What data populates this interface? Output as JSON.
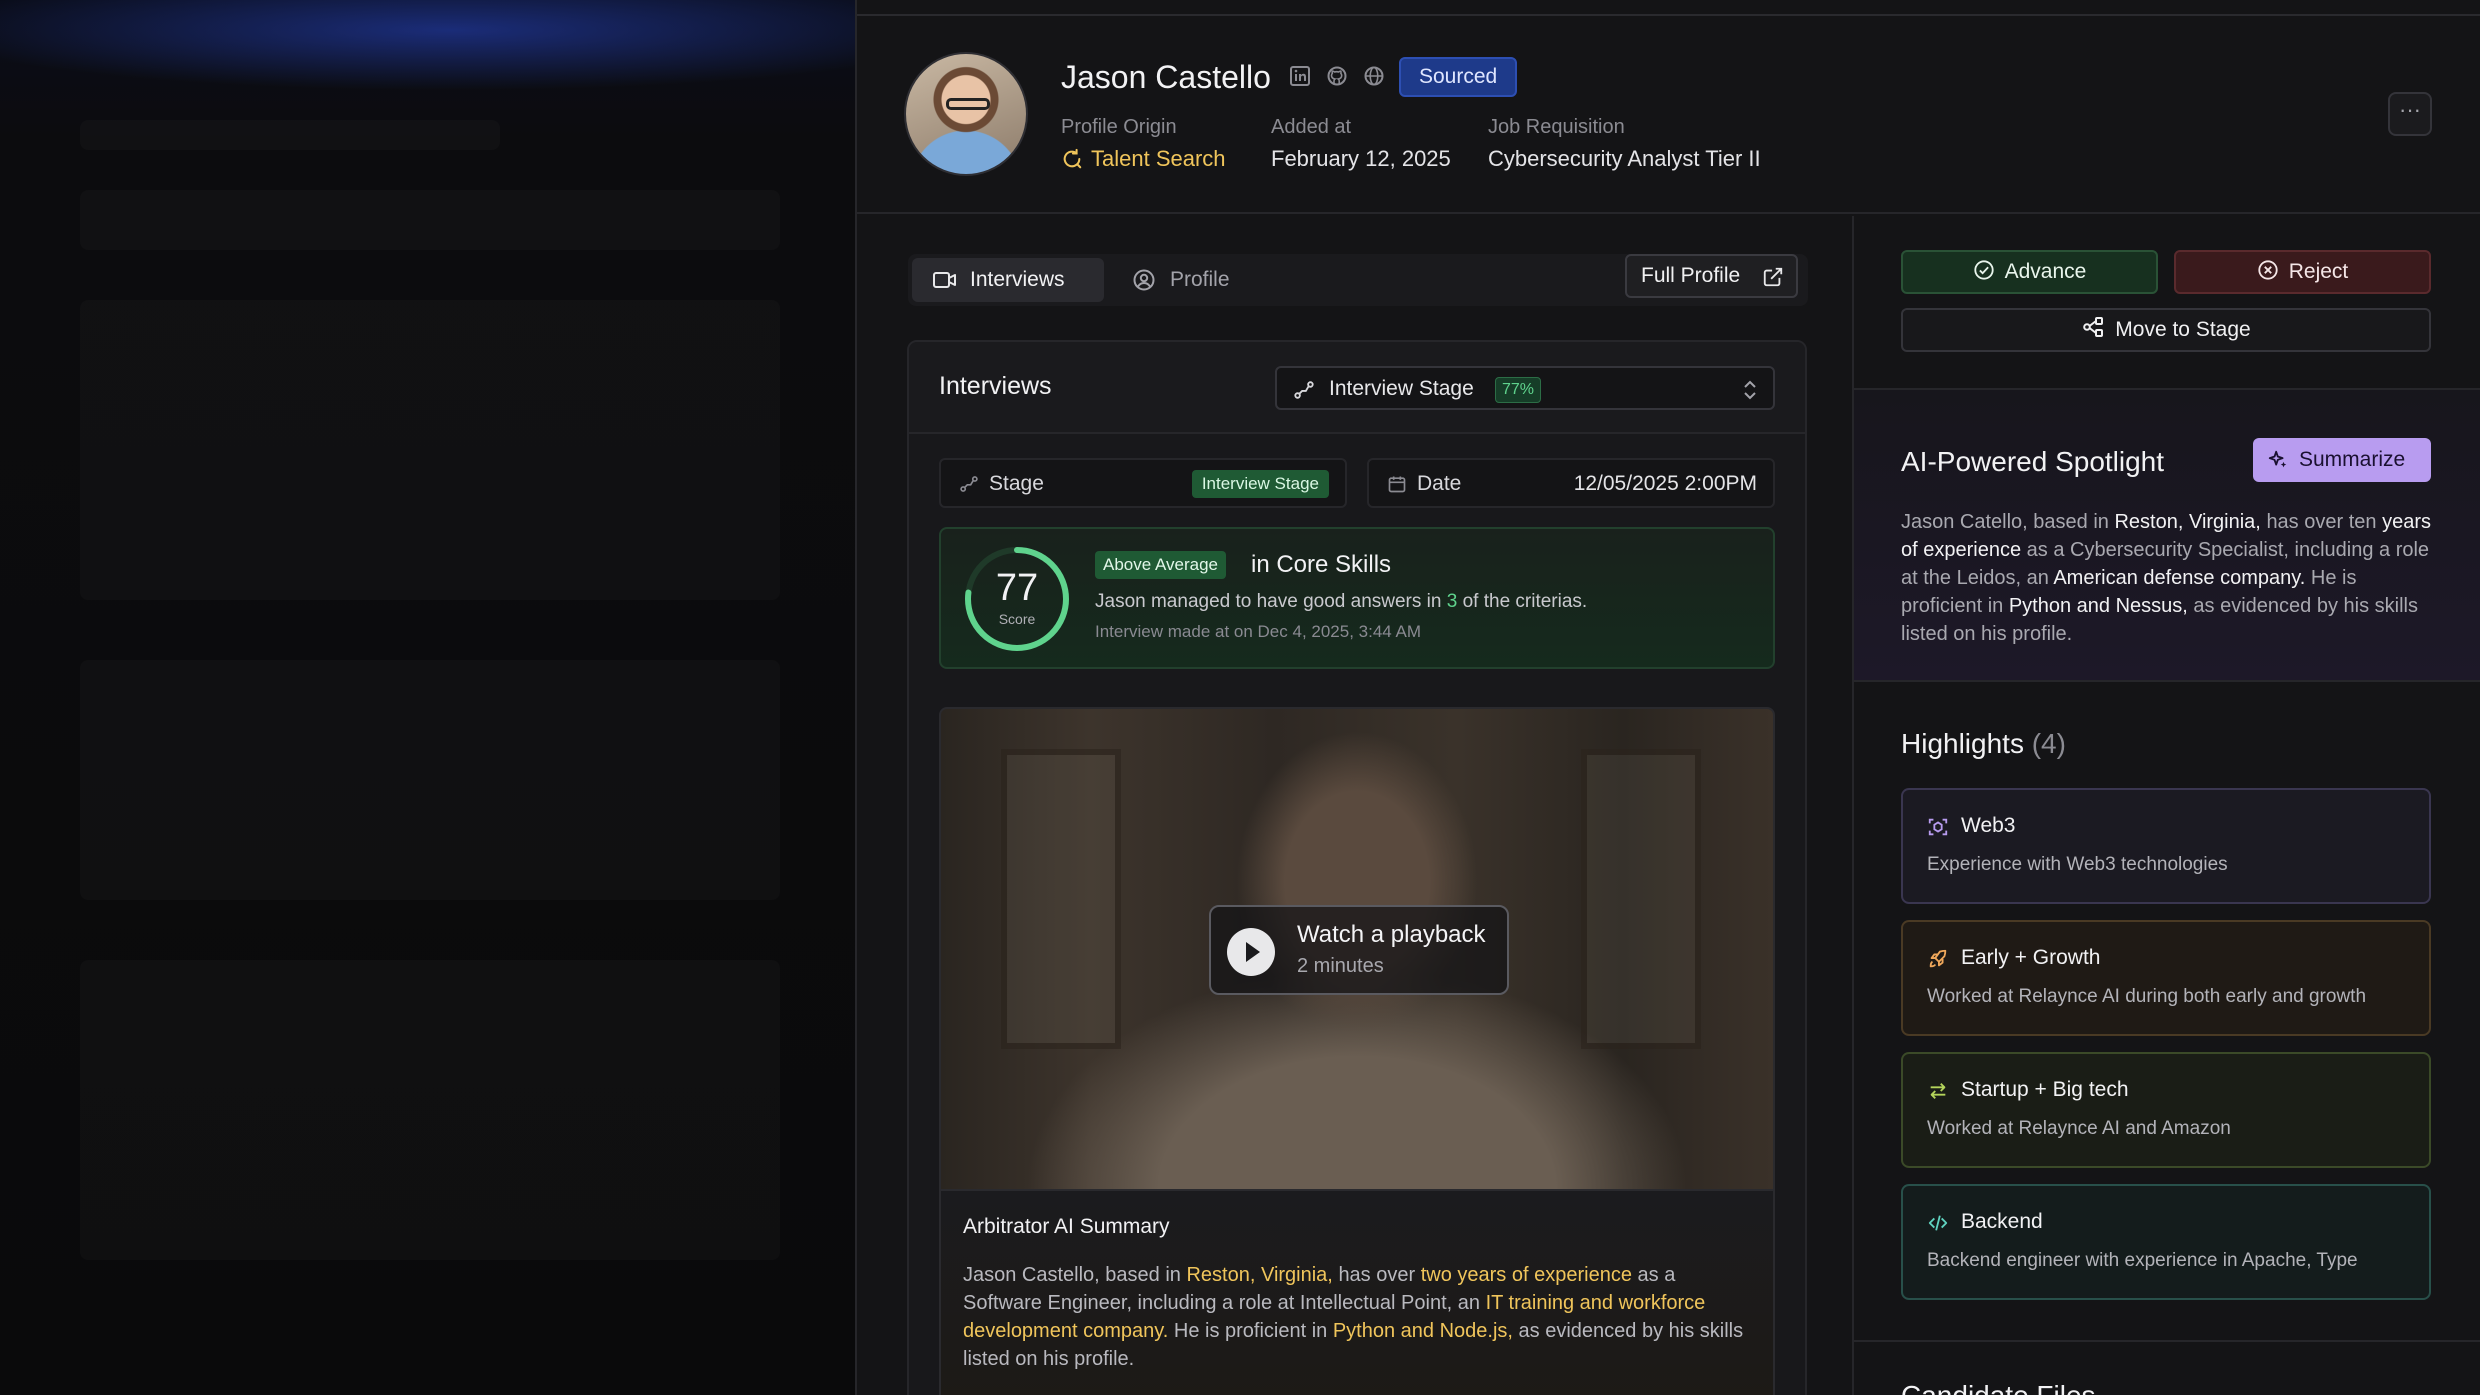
{
  "candidate": {
    "name": "Jason Castello",
    "status_badge": "Sourced",
    "profile_origin_label": "Profile Origin",
    "profile_origin_value": "Talent Search",
    "added_at_label": "Added at",
    "added_at_value": "February 12, 2025",
    "job_requisition_label": "Job Requisition",
    "job_requisition_value": "Cybersecurity Analyst Tier II",
    "social_icons": [
      "linkedin-icon",
      "github-icon",
      "globe-icon"
    ],
    "more_label": "···"
  },
  "tabs": [
    {
      "label": "Interviews",
      "active": true,
      "icon": "video-icon"
    },
    {
      "label": "Profile",
      "active": false,
      "icon": "user-circle-icon"
    }
  ],
  "full_profile_label": "Full Profile",
  "interviews": {
    "title": "Interviews",
    "stage_select_label": "Interview Stage",
    "stage_select_percent": "77%",
    "stage_label": "Stage",
    "stage_value": "Interview Stage",
    "date_label": "Date",
    "date_value": "12/05/2025 2:00PM",
    "score": {
      "value": "77",
      "value_fraction": 0.77,
      "sub": "Score",
      "level_pill": "Above Average",
      "headline": "in Core Skills",
      "desc_prefix": "Jason managed to have good answers in",
      "desc_count": "3",
      "desc_suffix": "of the criterias.",
      "made_at": "Interview made at on Dec 4, 2025, 3:44 AM"
    },
    "video": {
      "play_title": "Watch a playback",
      "play_sub": "2 minutes"
    },
    "summary": {
      "title": "Arbitrator AI Summary",
      "p1": "Jason Castello, based in",
      "h1": "Reston, Virginia,",
      "p2": "has over",
      "h2": "two years of experience",
      "p3": "as a Software Engineer, including a role at Intellectual Point, an",
      "h3": "IT training and workforce development company.",
      "p4": "He is proficient in",
      "h4": "Python and Node.js,",
      "p5": "as evidenced by his skills listed on his profile."
    }
  },
  "actions": {
    "advance": "Advance",
    "reject": "Reject",
    "move": "Move to Stage"
  },
  "spotlight": {
    "title": "AI-Powered Spotlight",
    "summarize": "Summarize",
    "t1": "Jason Catello, based in",
    "w1": "Reston, Virginia,",
    "t2": "has over ten",
    "w2": "years of experience",
    "t3": "as a Cybersecurity Specialist, including a role at the Leidos, an",
    "w3": "American defense company.",
    "t4": "He is proficient in",
    "w4": "Python and Nessus,",
    "t5": "as evidenced by his skills listed on his profile."
  },
  "highlights": {
    "title": "Highlights",
    "count": "(4)",
    "items": [
      {
        "title": "Web3",
        "desc": "Experience with Web3 technologies",
        "icon": "web3-icon"
      },
      {
        "title": "Early + Growth",
        "desc": "Worked at Relaynce AI during both early and growth",
        "icon": "rocket-icon"
      },
      {
        "title": "Startup + Big tech",
        "desc": "Worked at Relaynce AI and Amazon",
        "icon": "arrows-swap-icon"
      },
      {
        "title": "Backend",
        "desc": "Backend engineer with experience in Apache, Type",
        "icon": "code-icon"
      }
    ]
  },
  "candidate_files_title": "Candidate Files",
  "colors": {
    "accent_gold": "#f0c55b",
    "score_green": "#5fd38d",
    "sourced_blue": "#1e3a8a",
    "summarize_purple": "#b89cf0"
  }
}
